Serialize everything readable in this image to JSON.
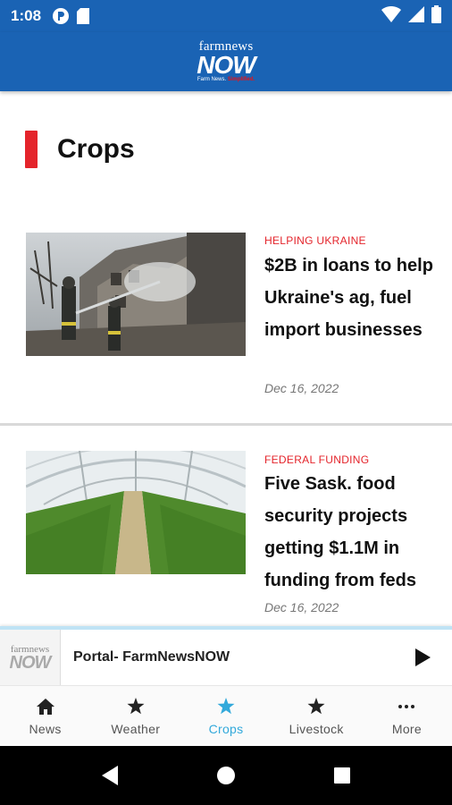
{
  "status_bar": {
    "time": "1:08",
    "icons": [
      "notification-icon",
      "sd-card-icon",
      "wifi-icon",
      "signal-icon",
      "battery-icon"
    ]
  },
  "app_bar": {
    "logo_top": "farmnews",
    "logo_main": "NOW",
    "logo_tag_a": "Farm News.",
    "logo_tag_b": "Simplified."
  },
  "section": {
    "title": "Crops",
    "accent_color": "#e4242b"
  },
  "articles": [
    {
      "category": "HELPING UKRAINE",
      "title": "$2B in loans to help Ukraine's ag, fuel import businesses",
      "date": "Dec 16, 2022",
      "image": "firefighters-ruined-building-photo"
    },
    {
      "category": "FEDERAL FUNDING",
      "title": "Five Sask. food security projects getting $1.1M in funding from feds",
      "date": "Dec 16, 2022",
      "image": "greenhouse-seedlings-photo"
    }
  ],
  "player": {
    "title": "Portal- FarmNewsNOW",
    "logo_top": "farmnews",
    "logo_main": "NOW",
    "play_icon": "play-icon"
  },
  "tabs": [
    {
      "label": "News",
      "icon": "home-icon",
      "active": false
    },
    {
      "label": "Weather",
      "icon": "star-icon",
      "active": false
    },
    {
      "label": "Crops",
      "icon": "star-icon",
      "active": true
    },
    {
      "label": "Livestock",
      "icon": "star-icon",
      "active": false
    },
    {
      "label": "More",
      "icon": "more-dots-icon",
      "active": false
    }
  ],
  "colors": {
    "brand_blue": "#1a63b4",
    "active_tab": "#33a9db",
    "category_red": "#e4242b"
  }
}
